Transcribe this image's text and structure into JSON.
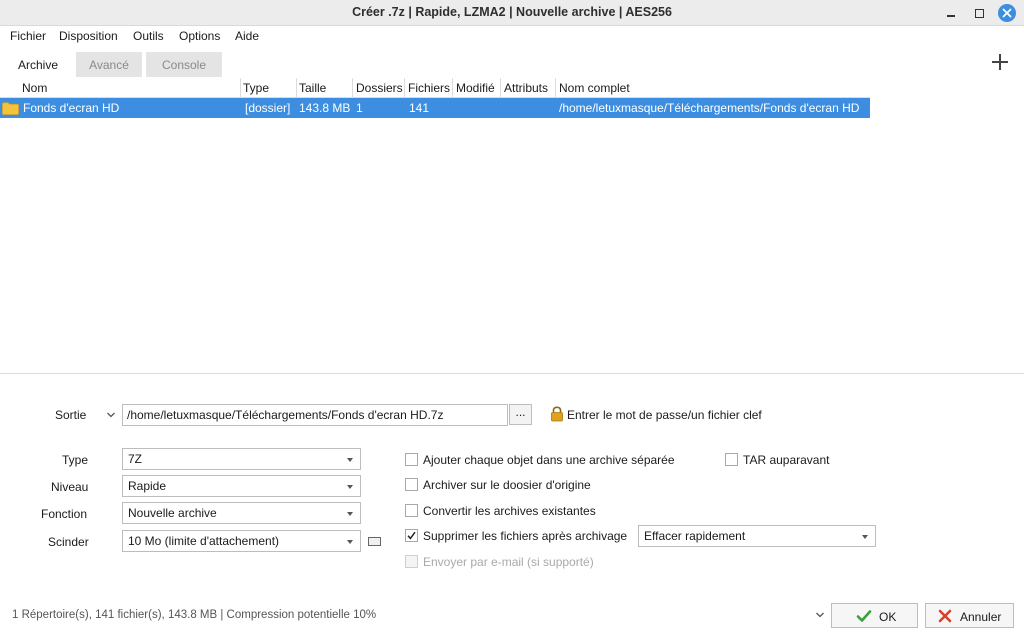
{
  "window": {
    "title": "Créer .7z | Rapide, LZMA2 | Nouvelle archive | AES256"
  },
  "menu": [
    "Fichier",
    "Disposition",
    "Outils",
    "Options",
    "Aide"
  ],
  "tabs": [
    "Archive",
    "Avancé",
    "Console"
  ],
  "table": {
    "columns": [
      "Nom",
      "Type",
      "Taille",
      "Dossiers",
      "Fichiers",
      "Modifié",
      "Attributs",
      "Nom complet"
    ],
    "rows": [
      {
        "name": "Fonds d'ecran HD",
        "type": "[dossier]",
        "size": "143.8 MB",
        "folders": "1",
        "files": "141",
        "modified": "",
        "attributes": "",
        "full_name": "/home/letuxmasque/Téléchargements/Fonds d'ecran HD"
      }
    ]
  },
  "output": {
    "label": "Sortie",
    "value": "/home/letuxmasque/Téléchargements/Fonds d'ecran HD.7z",
    "browse_label": "...",
    "password_label": "Entrer le mot de passe/un fichier clef"
  },
  "fields": {
    "type_label": "Type",
    "type_value": "7Z",
    "level_label": "Niveau",
    "level_value": "Rapide",
    "function_label": "Fonction",
    "function_value": "Nouvelle archive",
    "split_label": "Scinder",
    "split_value": "10 Mo (limite d'attachement)"
  },
  "checkboxes": {
    "separate": {
      "label": "Ajouter chaque objet dans une archive séparée",
      "checked": false
    },
    "tar_before": {
      "label": "TAR auparavant",
      "checked": false
    },
    "archive_origin": {
      "label": "Archiver sur le doosier d'origine",
      "checked": false
    },
    "convert": {
      "label": "Convertir les archives existantes",
      "checked": false
    },
    "delete_after": {
      "label": "Supprimer les fichiers après archivage",
      "checked": true
    },
    "email": {
      "label": "Envoyer par e-mail (si supporté)",
      "checked": false,
      "disabled": true
    }
  },
  "delete_mode": "Effacer rapidement",
  "status": "1 Répertoire(s), 141 fichier(s), 143.8 MB | Compression potentielle 10%",
  "buttons": {
    "ok": "OK",
    "cancel": "Annuler"
  },
  "colors": {
    "selection": "#3d8ee0",
    "ok_check": "#3aa13a",
    "cancel_x": "#d9402b",
    "close_button": "#3a8fe0",
    "lock": "#e0a21c",
    "folder": "#f3c33d"
  }
}
